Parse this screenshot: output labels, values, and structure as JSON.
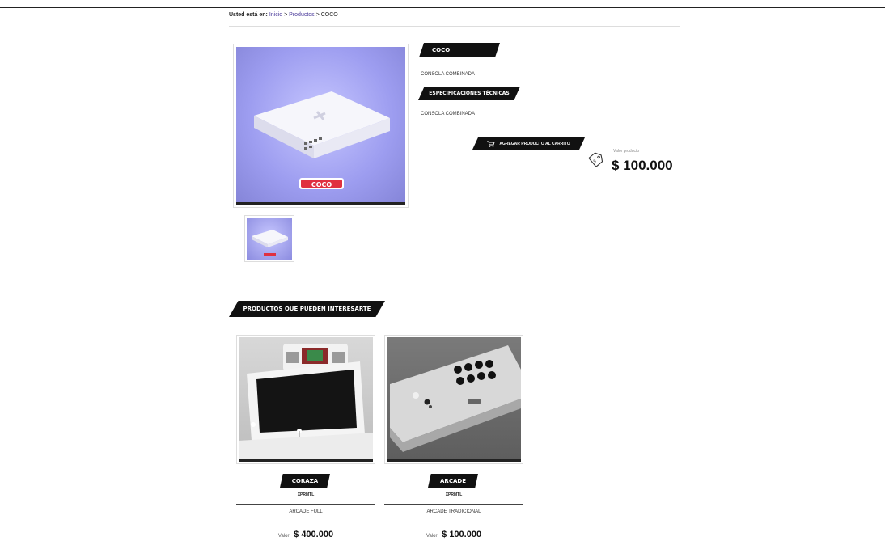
{
  "breadcrumb": {
    "prefix": "Usted está en:",
    "home": "Inicio",
    "sep1": ">",
    "products": "Productos",
    "sep2": ">",
    "current": "COCO"
  },
  "product": {
    "name": "COCO",
    "short_description": "CONSOLA COMBINADA",
    "specs_heading": "ESPECIFICACIONES TÉCNICAS",
    "specs_text": "CONSOLA COMBINADA",
    "add_to_cart_label": "AGREGAR PRODUCTO AL CARRITO",
    "price_label": "Valor producto",
    "price": "$ 100.000",
    "image_logo_text": "COCO"
  },
  "related": {
    "heading": "PRODUCTOS QUE PUEDEN INTERESARTE",
    "value_label": "Valor:",
    "items": [
      {
        "name": "CORAZA",
        "brand": "XPRMTL",
        "description": "ARCADE FULL",
        "price": "$ 400.000"
      },
      {
        "name": "ARCADE",
        "brand": "XPRMTL",
        "description": "ARCADE TRADICIONAL",
        "price": "$ 100.000"
      }
    ]
  },
  "colors": {
    "accent": "#111111",
    "image_bg": "#9d9df0",
    "link": "#4a3a9a"
  }
}
